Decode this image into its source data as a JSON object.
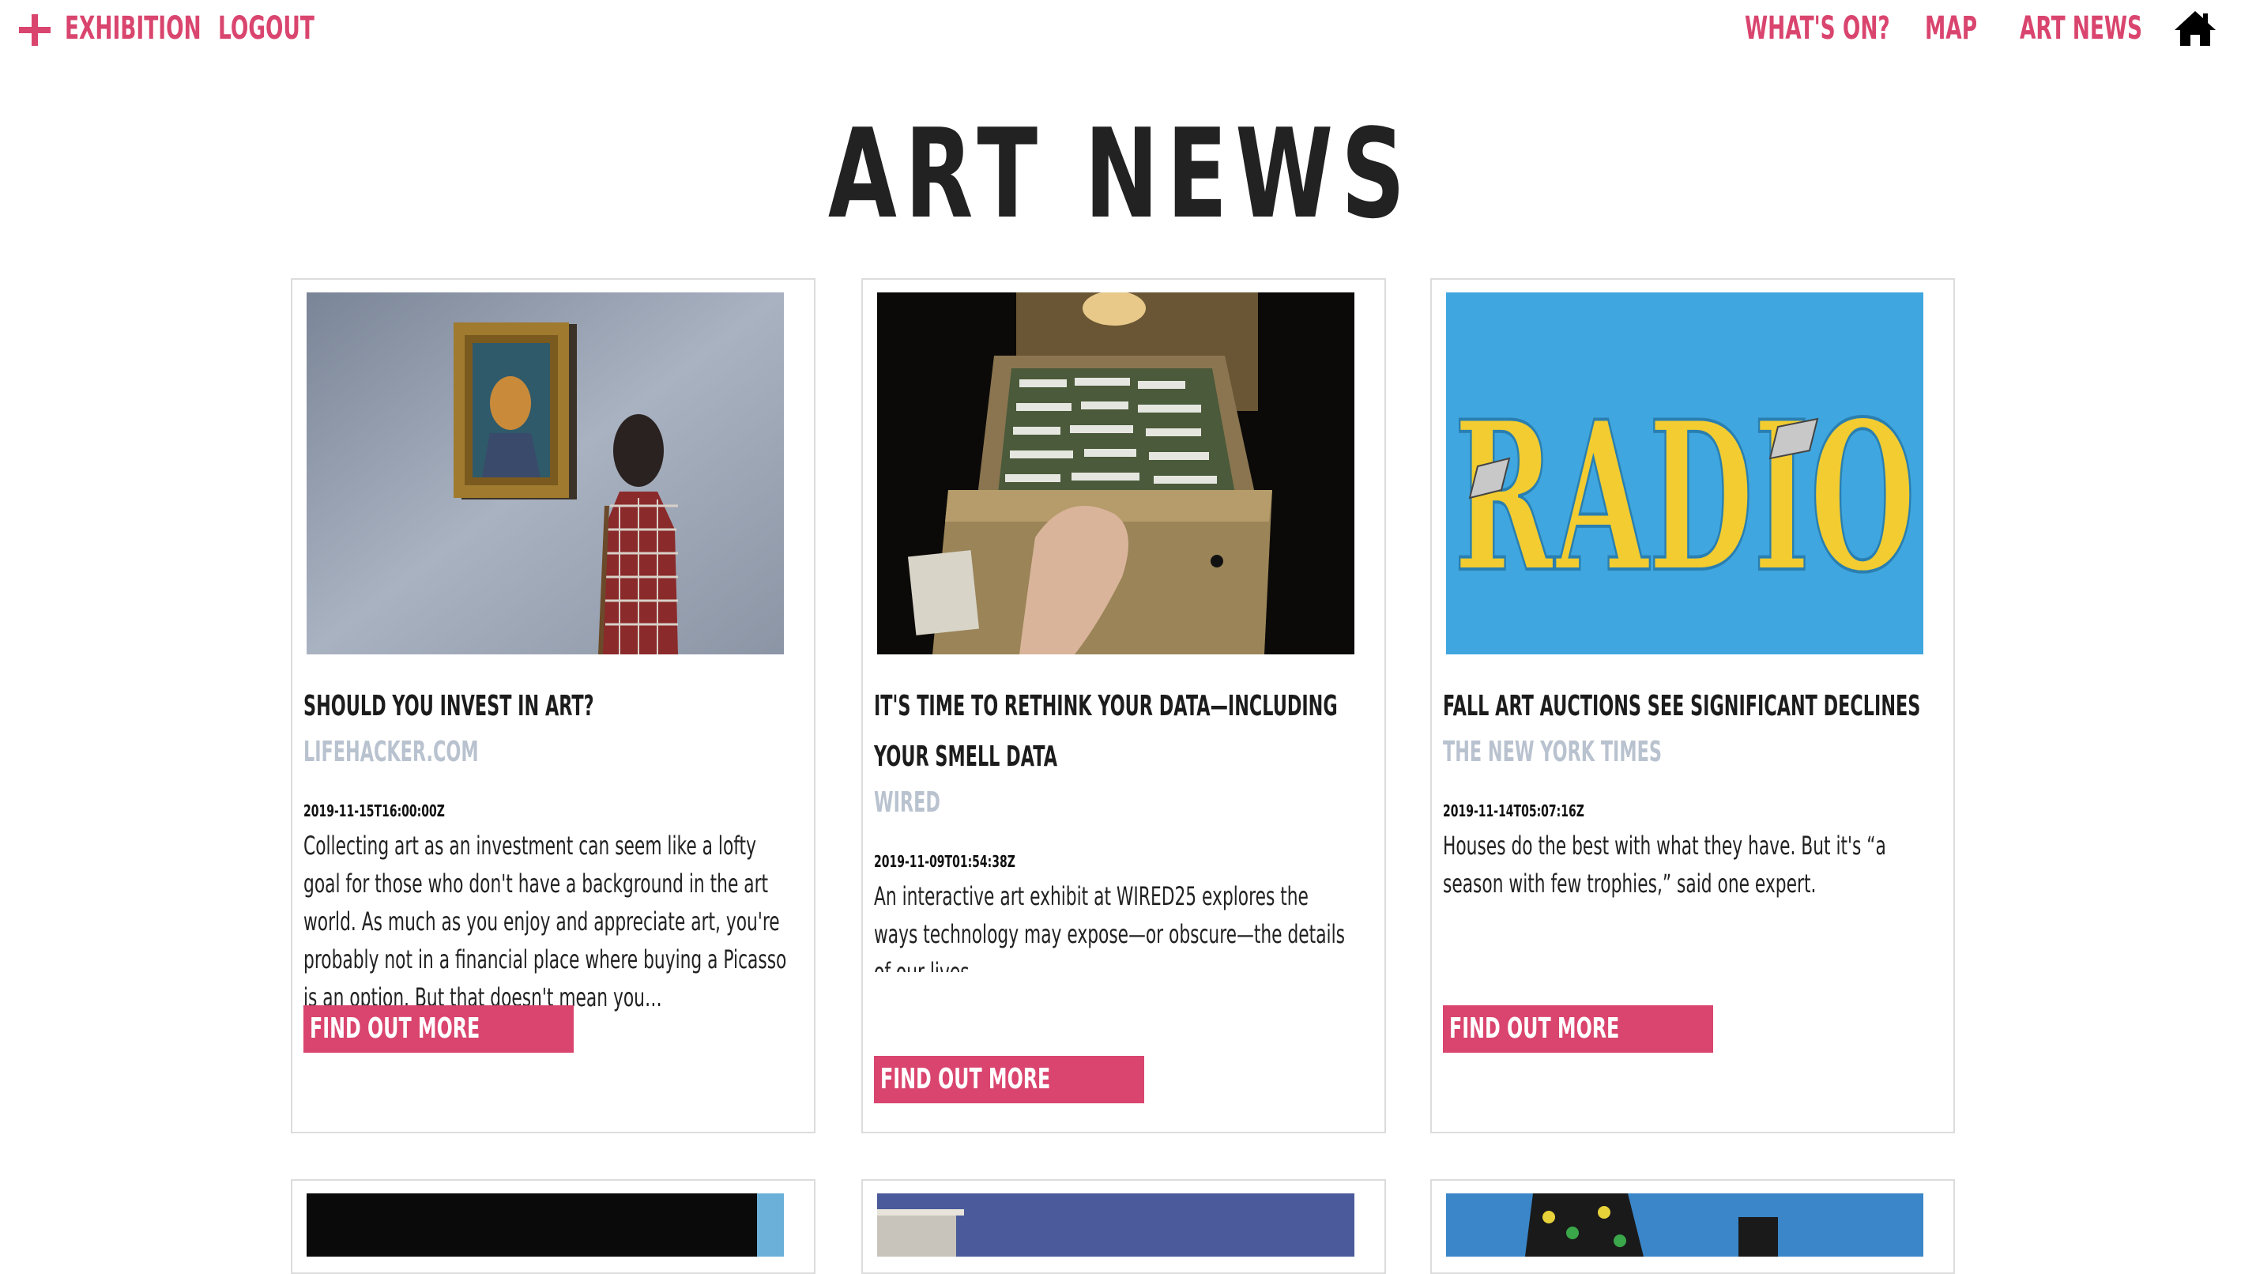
{
  "nav": {
    "add_exhibition_label": "Exhibition",
    "logout_label": "Logout",
    "whats_on_label": "What's On?",
    "map_label": "Map",
    "art_news_label": "Art News"
  },
  "page": {
    "title": "ART NEWS"
  },
  "colors": {
    "accent": "#d9456e",
    "source_gray": "#b9c2cf",
    "title_dark": "#222222"
  },
  "articles": [
    {
      "title": "Should you invest in art?",
      "source": "Lifehacker.com",
      "date": "2019-11-15T16:00:00Z",
      "description": "Collecting art as an investment can seem like a lofty goal for those who don't have a background in the art world. As much as you enjoy and appreciate art, you're probably not in a financial place where buying a Picasso is an option. But that doesn't mean you…",
      "button_label": "Find out more"
    },
    {
      "title": "It's Time to Rethink Your Data—Including Your Smell Data",
      "source": "Wired",
      "date": "2019-11-09T01:54:38Z",
      "description": "An interactive art exhibit at WIRED25 explores the ways technology may expose—or obscure—the details of our lives.",
      "button_label": "Find out more"
    },
    {
      "title": "Fall Art Auctions See Significant Declines",
      "source": "The New York Times",
      "date": "2019-11-14T05:07:16Z",
      "description": "Houses do the best with what they have. But it's “a season with few trophies,” said one expert.",
      "button_label": "Find out more"
    }
  ]
}
